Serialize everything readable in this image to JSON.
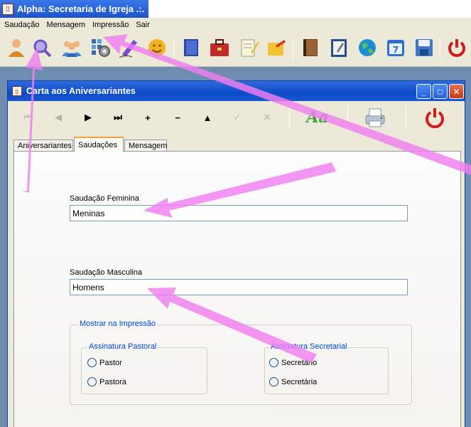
{
  "app": {
    "title": "Alpha: Secretaria de Igreja .:.",
    "icon_name": "book-icon"
  },
  "menu": [
    {
      "label": "Saudação"
    },
    {
      "label": "Mensagem"
    },
    {
      "label": "Impressão"
    },
    {
      "label": "Sair"
    }
  ],
  "toolbar_icons": [
    {
      "name": "user-icon",
      "color": "#e0852a"
    },
    {
      "name": "search-icon",
      "color": "#6a56c8"
    },
    {
      "name": "group-icon",
      "color": "#4a86d8"
    },
    {
      "name": "settings-grid-icon",
      "color": "#3a66b8"
    },
    {
      "name": "pen-icon",
      "color": "#7a4bd0"
    },
    {
      "name": "smiley-icon",
      "color": "#f3b21d"
    },
    {
      "name": "notebook-icon",
      "color": "#2c46a6"
    },
    {
      "name": "toolbox-icon",
      "color": "#c32a2a"
    },
    {
      "name": "notepad-icon",
      "color": "#e5c34a"
    },
    {
      "name": "sticky-note-icon",
      "color": "#f1c232"
    },
    {
      "name": "address-book-icon",
      "color": "#6b4220"
    },
    {
      "name": "clipboard-icon",
      "color": "#2a4f90"
    },
    {
      "name": "globe-icon",
      "color": "#1b8ed6"
    },
    {
      "name": "calendar-icon",
      "color": "#2b6fd3"
    },
    {
      "name": "save-icon",
      "color": "#3f76c8"
    },
    {
      "name": "power-icon",
      "color": "#d21b1b"
    }
  ],
  "child_window": {
    "title": "Carta aos Aniversariantes",
    "buttons": {
      "minimize": "_",
      "maximize": "□",
      "close": "✕"
    }
  },
  "nav": [
    {
      "name": "first-record-icon",
      "glyph": "⏮",
      "enabled": false
    },
    {
      "name": "prev-record-icon",
      "glyph": "◀",
      "enabled": false
    },
    {
      "name": "next-record-icon",
      "glyph": "▶",
      "enabled": true
    },
    {
      "name": "last-record-icon",
      "glyph": "⏭",
      "enabled": true
    },
    {
      "name": "add-record-icon",
      "glyph": "+",
      "enabled": true
    },
    {
      "name": "delete-record-icon",
      "glyph": "−",
      "enabled": true
    },
    {
      "name": "edit-record-icon",
      "glyph": "▲",
      "enabled": true
    },
    {
      "name": "post-record-icon",
      "glyph": "✓",
      "enabled": false
    },
    {
      "name": "cancel-record-icon",
      "glyph": "✕",
      "enabled": false
    }
  ],
  "nav_extra": {
    "font_glyph": "Aa",
    "printer_icon": "printer-icon",
    "power_icon": "power-icon"
  },
  "tabs": [
    {
      "label": "Aniversariantes",
      "active": false
    },
    {
      "label": "Saudações",
      "active": true
    },
    {
      "label": "Mensagem",
      "active": false
    }
  ],
  "form": {
    "feminine_label": "Saudação Feminina",
    "feminine_value": "Meninas",
    "masculine_label": "Saudação Masculina",
    "masculine_value": "Homens",
    "print_group_caption": "Mostrar na Impressão",
    "pastoral_caption": "Assinatura Pastoral",
    "pastoral_options": [
      "Pastor",
      "Pastora"
    ],
    "secretarial_caption": "Assinatura Secretarial",
    "secretarial_options": [
      "Secretário",
      "Secretária"
    ]
  },
  "accent": {
    "title_bar": "#1d55c9",
    "annotation": "#f07ff0"
  }
}
